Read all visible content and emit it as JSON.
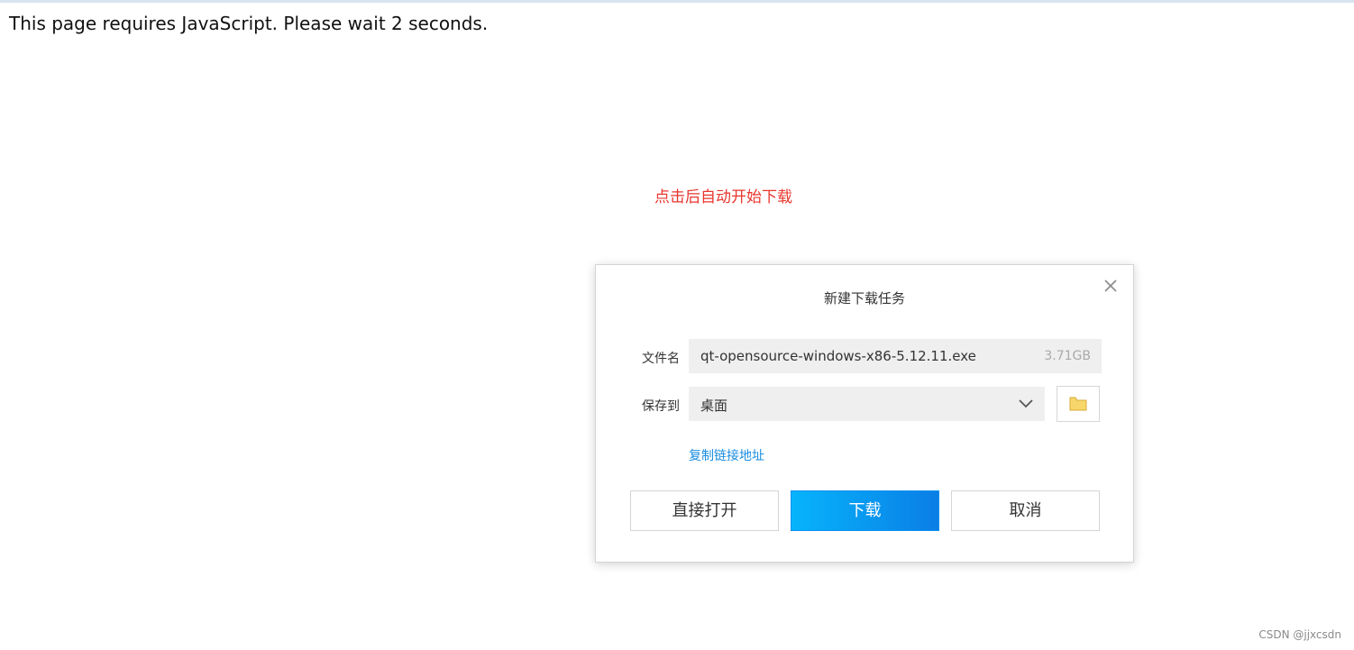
{
  "page": {
    "notice": "This page requires JavaScript. Please wait 2 seconds.",
    "hint": "点击后自动开始下载",
    "watermark": "CSDN @jjxcsdn"
  },
  "dialog": {
    "title": "新建下载任务",
    "close_icon": "close-icon",
    "file_name_label": "文件名",
    "file_name_value": "qt-opensource-windows-x86-5.12.11.exe",
    "file_size": "3.71GB",
    "save_to_label": "保存到",
    "save_to_value": "桌面",
    "dropdown_icon": "chevron-down-icon",
    "folder_icon": "folder-icon",
    "copy_link": "复制链接地址",
    "buttons": {
      "open": "直接打开",
      "download": "下载",
      "cancel": "取消"
    }
  },
  "colors": {
    "hint": "#e8362d",
    "link": "#1a8de0",
    "download_button_start": "#07b4fb",
    "download_button_end": "#0a7ee6",
    "folder_icon": "#f7d76a"
  }
}
